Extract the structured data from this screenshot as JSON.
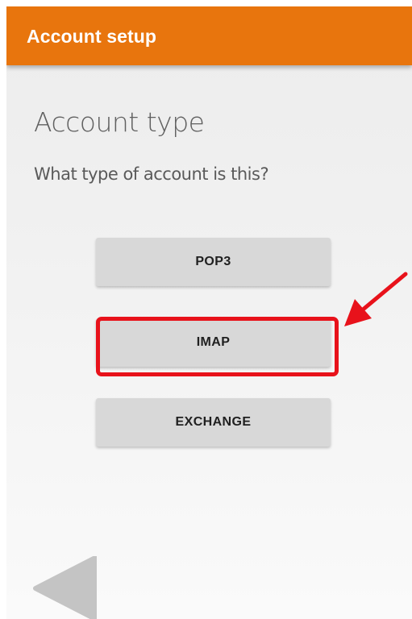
{
  "app_bar": {
    "title": "Account setup"
  },
  "main": {
    "title": "Account type",
    "question": "What type of account is this?",
    "options": [
      {
        "label": "POP3"
      },
      {
        "label": "IMAP"
      },
      {
        "label": "EXCHANGE"
      }
    ]
  },
  "annotation": {
    "highlighted_option": "IMAP",
    "color": "#e8121b"
  },
  "colors": {
    "app_bar": "#e8750d",
    "button": "#d8d8d8",
    "back_arrow": "#c4c4c4"
  },
  "icons": {
    "back": "back-arrow-icon",
    "pointer": "red-arrow-icon"
  }
}
